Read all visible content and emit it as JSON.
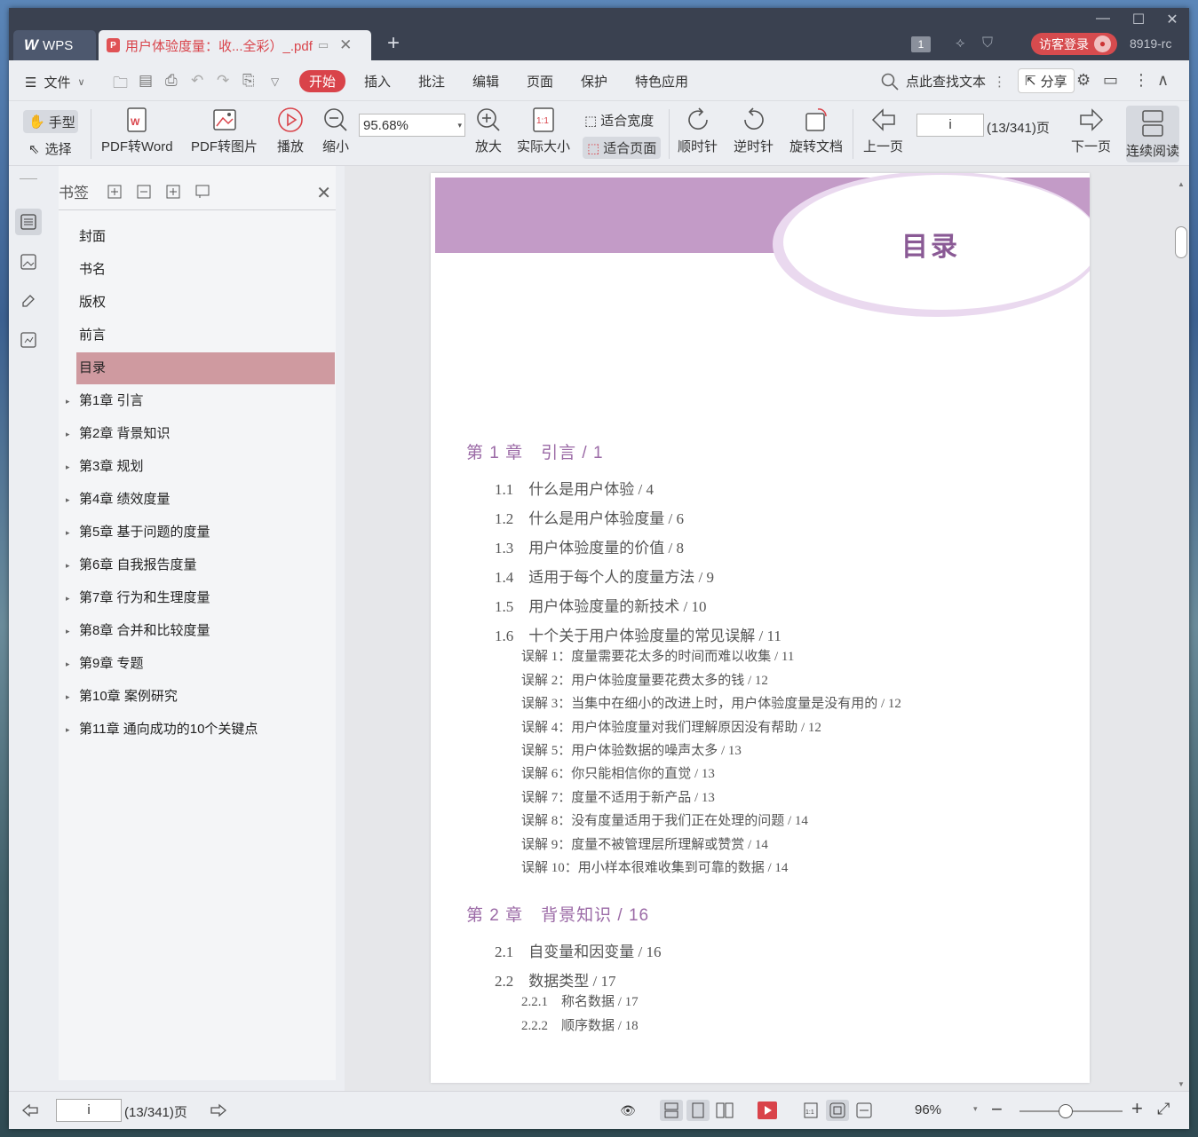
{
  "titlebar": {
    "wps_tab": "WPS",
    "doc_tab": "用户体验度量：收...全彩）_.pdf",
    "doc_number": "1",
    "login": "访客登录",
    "user_id": "8919-rc"
  },
  "menubar": {
    "file": "文件",
    "tabs": [
      "开始",
      "插入",
      "批注",
      "编辑",
      "页面",
      "保护",
      "特色应用"
    ],
    "search": "点此查找文本",
    "share": "分享"
  },
  "toolbar": {
    "hand": "手型",
    "select": "选择",
    "pdf_to_word": "PDF转Word",
    "pdf_to_image": "PDF转图片",
    "play": "播放",
    "zoom_out": "缩小",
    "zoom_value": "95.68%",
    "zoom_in": "放大",
    "actual_size": "实际大小",
    "fit_width": "适合宽度",
    "fit_page": "适合页面",
    "clockwise": "顺时针",
    "counter_clockwise": "逆时针",
    "rotate_doc": "旋转文档",
    "prev_page": "上一页",
    "page_value": "i",
    "page_count": "(13/341)页",
    "next_page": "下一页",
    "continuous": "连续阅读"
  },
  "bookmarks": {
    "title": "书签",
    "items": [
      {
        "label": "封面",
        "expandable": false
      },
      {
        "label": "书名",
        "expandable": false
      },
      {
        "label": "版权",
        "expandable": false
      },
      {
        "label": "前言",
        "expandable": false
      },
      {
        "label": "目录",
        "expandable": false,
        "selected": true
      },
      {
        "label": "第1章 引言",
        "expandable": true
      },
      {
        "label": "第2章 背景知识",
        "expandable": true
      },
      {
        "label": "第3章 规划",
        "expandable": true
      },
      {
        "label": "第4章 绩效度量",
        "expandable": true
      },
      {
        "label": "第5章 基于问题的度量",
        "expandable": true
      },
      {
        "label": "第6章 自我报告度量",
        "expandable": true
      },
      {
        "label": "第7章 行为和生理度量",
        "expandable": true
      },
      {
        "label": "第8章 合并和比较度量",
        "expandable": true
      },
      {
        "label": "第9章 专题",
        "expandable": true
      },
      {
        "label": "第10章 案例研究",
        "expandable": true
      },
      {
        "label": "第11章 通向成功的10个关键点",
        "expandable": true
      }
    ]
  },
  "document": {
    "heading": "目录",
    "lines": [
      {
        "kind": "ch",
        "text": "第 1 章　引言 / 1"
      },
      {
        "kind": "sec",
        "text": "1.1　什么是用户体验 / 4"
      },
      {
        "kind": "sec",
        "text": "1.2　什么是用户体验度量 / 6"
      },
      {
        "kind": "sec",
        "text": "1.3　用户体验度量的价值 / 8"
      },
      {
        "kind": "sec",
        "text": "1.4　适用于每个人的度量方法 / 9"
      },
      {
        "kind": "sec",
        "text": "1.5　用户体验度量的新技术 / 10"
      },
      {
        "kind": "sec",
        "text": "1.6　十个关于用户体验度量的常见误解 / 11"
      },
      {
        "kind": "sub",
        "text": "误解 1：度量需要花太多的时间而难以收集 / 11"
      },
      {
        "kind": "sub",
        "text": "误解 2：用户体验度量要花费太多的钱 / 12"
      },
      {
        "kind": "sub",
        "text": "误解 3：当集中在细小的改进上时，用户体验度量是没有用的 / 12"
      },
      {
        "kind": "sub",
        "text": "误解 4：用户体验度量对我们理解原因没有帮助 / 12"
      },
      {
        "kind": "sub",
        "text": "误解 5：用户体验数据的噪声太多 / 13"
      },
      {
        "kind": "sub",
        "text": "误解 6：你只能相信你的直觉 / 13"
      },
      {
        "kind": "sub",
        "text": "误解 7：度量不适用于新产品 / 13"
      },
      {
        "kind": "sub",
        "text": "误解 8：没有度量适用于我们正在处理的问题 / 14"
      },
      {
        "kind": "sub",
        "text": "误解 9：度量不被管理层所理解或赞赏 / 14"
      },
      {
        "kind": "sub",
        "text": "误解 10：用小样本很难收集到可靠的数据 / 14"
      },
      {
        "kind": "ch",
        "text": "第 2 章　背景知识 / 16"
      },
      {
        "kind": "sec",
        "text": "2.1　自变量和因变量 / 16"
      },
      {
        "kind": "sec",
        "text": "2.2　数据类型 / 17"
      },
      {
        "kind": "sub",
        "text": "2.2.1　称名数据 / 17"
      },
      {
        "kind": "sub",
        "text": "2.2.2　顺序数据 / 18"
      }
    ]
  },
  "statusbar": {
    "page_value": "i",
    "page_count": "(13/341)页",
    "zoom": "96%"
  }
}
